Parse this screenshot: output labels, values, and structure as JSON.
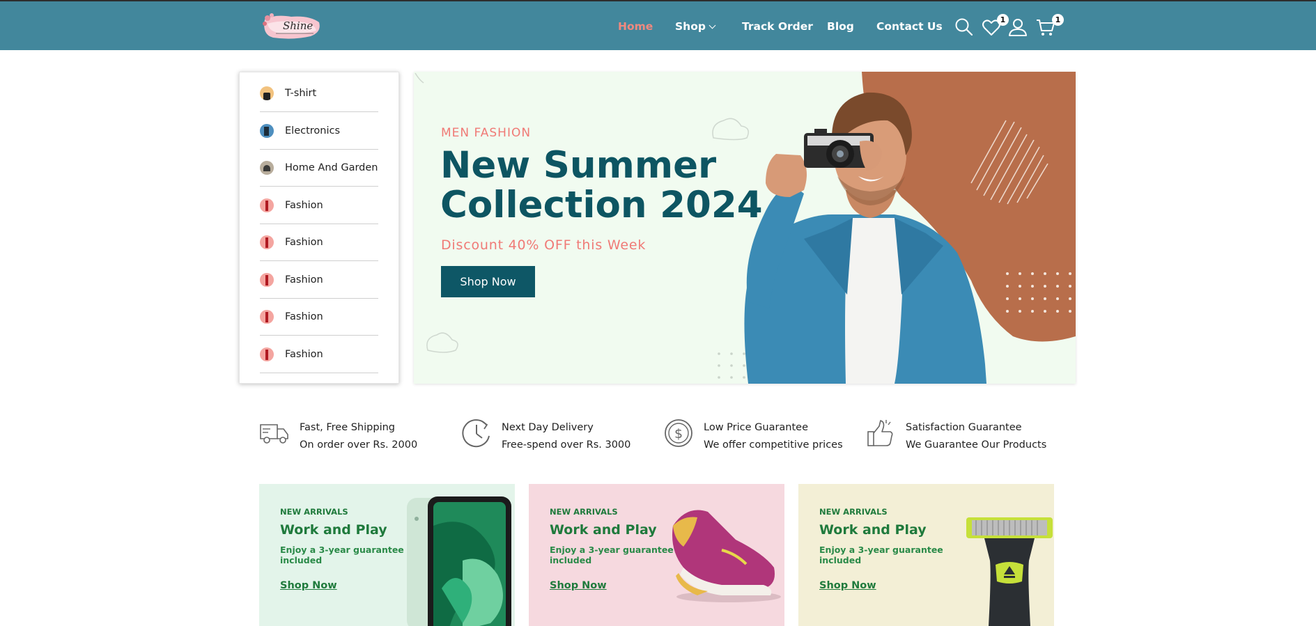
{
  "header": {
    "logo_text": "Shine",
    "nav": [
      {
        "label": "Home",
        "active": true
      },
      {
        "label": "Shop",
        "dropdown": true
      },
      {
        "label": "Track Order"
      },
      {
        "label": "Blog"
      },
      {
        "label": "Contact Us"
      }
    ],
    "icons": [
      "search-icon",
      "heart-icon",
      "user-icon",
      "cart-icon"
    ],
    "wishlist_count": "1",
    "cart_count": "1"
  },
  "sidebar": {
    "categories": [
      {
        "label": "T-shirt",
        "icon": "tshirt-thumb"
      },
      {
        "label": "Electronics",
        "icon": "electronics-thumb"
      },
      {
        "label": "Home And Garden",
        "icon": "home-garden-thumb"
      },
      {
        "label": "Fashion",
        "icon": "lipstick-thumb"
      },
      {
        "label": "Fashion",
        "icon": "lipstick-thumb"
      },
      {
        "label": "Fashion",
        "icon": "lipstick-thumb"
      },
      {
        "label": "Fashion",
        "icon": "lipstick-thumb"
      },
      {
        "label": "Fashion",
        "icon": "lipstick-thumb"
      }
    ]
  },
  "hero": {
    "kicker": "MEN FASHION",
    "title": "New Summer Collection 2024",
    "discount": "Discount 40% OFF this Week",
    "button": "Shop Now"
  },
  "features": [
    {
      "icon": "truck-icon",
      "title": "Fast, Free Shipping",
      "subtitle": "On order over Rs. 2000"
    },
    {
      "icon": "clock-icon",
      "title": "Next Day Delivery",
      "subtitle": "Free-spend over Rs. 3000"
    },
    {
      "icon": "dollar-icon",
      "title": "Low Price Guarantee",
      "subtitle": "We offer competitive prices"
    },
    {
      "icon": "thumbs-up-icon",
      "title": "Satisfaction Guarantee",
      "subtitle": "We Guarantee Our Products"
    }
  ],
  "promos": [
    {
      "kicker": "NEW ARRIVALS",
      "title": "Work and Play",
      "subtitle": "Enjoy a 3-year guarantee included",
      "link": "Shop Now",
      "bg": "#e3f4ea"
    },
    {
      "kicker": "NEW ARRIVALS",
      "title": "Work and Play",
      "subtitle": "Enjoy a 3-year guarantee included",
      "link": "Shop Now",
      "bg": "#f6d9df"
    },
    {
      "kicker": "NEW ARRIVALS",
      "title": "Work and Play",
      "subtitle": "Enjoy a 3-year guarantee included",
      "link": "Shop Now",
      "bg": "#f3efd6"
    }
  ],
  "colors": {
    "header_bg": "#42879c",
    "active_nav": "#f0897f",
    "hero_title": "#0d5562",
    "hero_accent": "#f07a76",
    "promo_green": "#1f7a3c"
  }
}
